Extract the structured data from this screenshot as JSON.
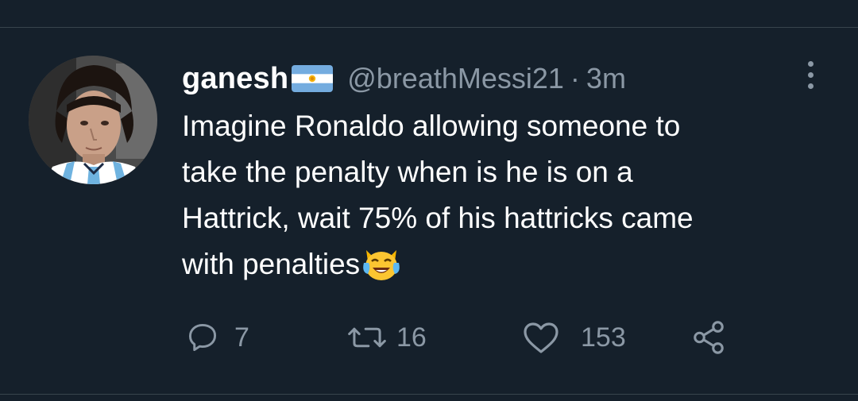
{
  "tweet": {
    "author_name": "ganesh",
    "author_flag_icon": "argentina-flag-icon",
    "handle": "@breathMessi21",
    "separator": "·",
    "timestamp": "3m",
    "text_lines": [
      "Imagine Ronaldo allowing someone to",
      "take the penalty when is he is on a",
      "Hattrick, wait 75% of his hattricks came",
      "with penalties"
    ],
    "text_emoji_icon": "tears-of-joy-cat-emoji",
    "actions": {
      "reply_count": "7",
      "retweet_count": "16",
      "like_count": "153"
    }
  },
  "colors": {
    "background": "#15202b",
    "primary_text": "#ffffff",
    "secondary_text": "#8b98a5",
    "divider": "#38444d"
  }
}
